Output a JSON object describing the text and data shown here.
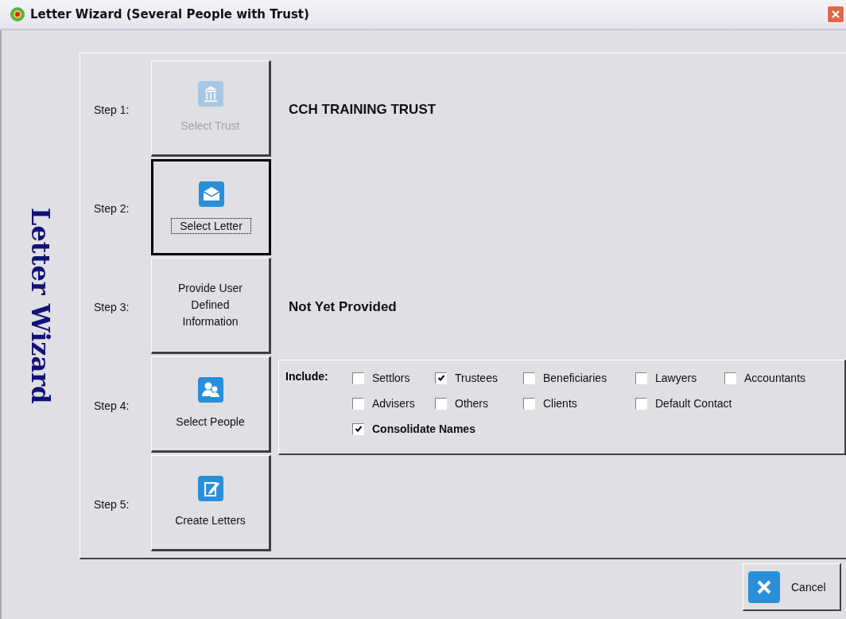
{
  "window": {
    "title": "Letter Wizard (Several People with Trust)"
  },
  "side_title": "Letter Wizard",
  "steps": [
    {
      "label": "Step 1:",
      "button": "Select Trust",
      "kind": "trust",
      "disabled": true,
      "focused": false,
      "info": "CCH TRAINING TRUST"
    },
    {
      "label": "Step 2:",
      "button": "Select Letter",
      "kind": "letter",
      "disabled": false,
      "focused": true
    },
    {
      "label": "Step 3:",
      "button": "Provide User Defined Information",
      "kind": "text",
      "disabled": false,
      "focused": false,
      "info": "Not Yet Provided"
    },
    {
      "label": "Step 4:",
      "button": "Select People",
      "kind": "people",
      "disabled": false,
      "focused": false,
      "include": {
        "label": "Include:",
        "options": [
          {
            "label": "Settlors",
            "checked": false
          },
          {
            "label": "Trustees",
            "checked": true
          },
          {
            "label": "Beneficiaries",
            "checked": false
          },
          {
            "label": "Lawyers",
            "checked": false
          },
          {
            "label": "Accountants",
            "checked": false
          },
          {
            "label": "Advisers",
            "checked": false
          },
          {
            "label": "Others",
            "checked": false
          },
          {
            "label": "Clients",
            "checked": false
          },
          {
            "label": "Default Contact",
            "checked": false
          }
        ],
        "consolidate": {
          "label": "Consolidate Names",
          "checked": true
        }
      }
    },
    {
      "label": "Step 5:",
      "button": "Create Letters",
      "kind": "create",
      "disabled": false,
      "focused": false
    }
  ],
  "cancel_button": "Cancel"
}
